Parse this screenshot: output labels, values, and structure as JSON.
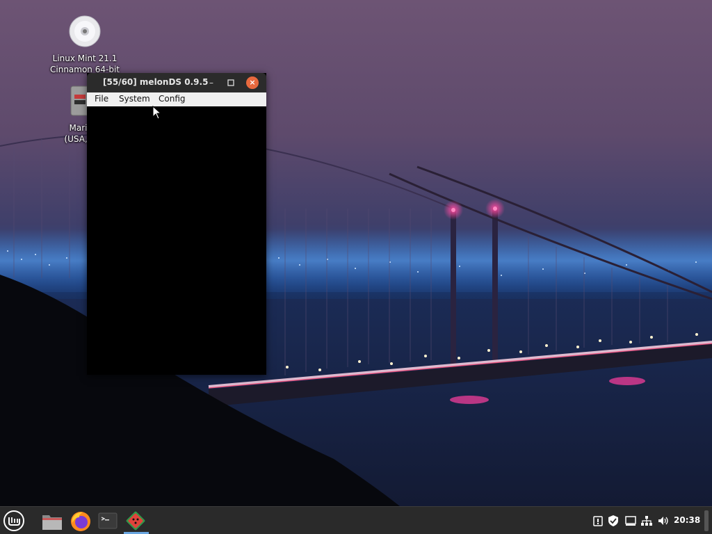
{
  "desktop": {
    "icons": [
      {
        "label_line1": "Linux Mint 21.1",
        "label_line2": "Cinnamon 64-bit",
        "icon": "disc-icon"
      },
      {
        "label_line1": "Mario K",
        "label_line2": "(USA, Aus",
        "icon": "rom-file-icon"
      }
    ]
  },
  "window": {
    "title": "[55/60] melonDS 0.9.5",
    "controls": {
      "minimize": "–",
      "maximize": "□",
      "close": "×"
    },
    "menu": [
      "File",
      "System",
      "Config"
    ]
  },
  "panel": {
    "launchers": [
      "menu-icon",
      "files-icon",
      "firefox-icon",
      "terminal-icon",
      "melonds-icon"
    ],
    "tray_icons": [
      "update-manager-icon",
      "shield-icon",
      "display-icon",
      "network-icon",
      "volume-icon"
    ],
    "clock": "20:38"
  },
  "colors": {
    "panel": "#2a2a2a",
    "titlebar": "#2b2b2b",
    "close_button": "#e8693e",
    "menubar": "#f0f0f0",
    "active_task_indicator": "#6aa6e0"
  }
}
